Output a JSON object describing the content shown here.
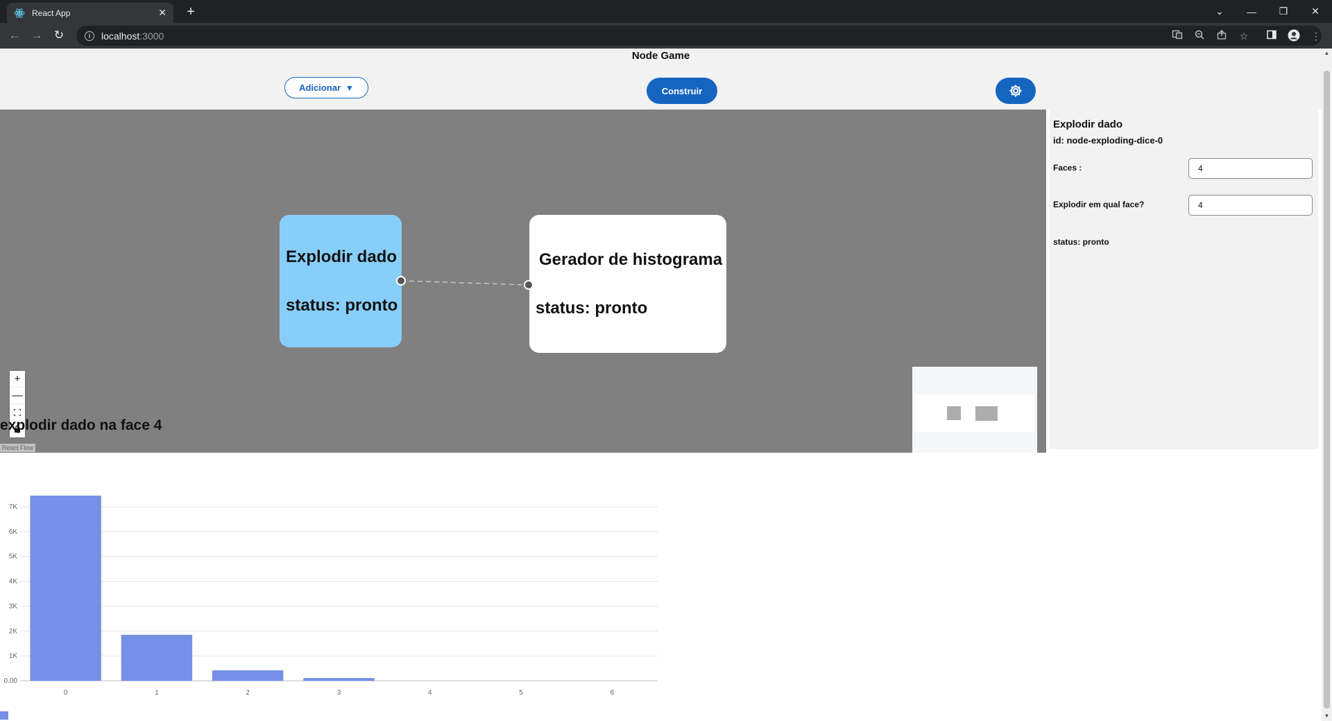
{
  "browser": {
    "tab_title": "React App",
    "tab_close": "✕",
    "new_tab": "+",
    "url_host": "localhost",
    "url_port": ":3000",
    "minimize": "—",
    "restore": "❐",
    "close": "✕",
    "tab_search": "⌄"
  },
  "app": {
    "title": "Node Game",
    "add_button": "Adicionar",
    "add_caret": "▼",
    "build_button": "Construir"
  },
  "flow": {
    "nodes": [
      {
        "title": "Explodir dado",
        "status": "status: pronto",
        "color": "#87cefa"
      },
      {
        "title": "Gerador de histograma",
        "status": "status: pronto",
        "color": "#ffffff"
      }
    ],
    "controls": {
      "zoom_in": "+",
      "zoom_out": "—",
      "fit": "⛶",
      "lock": "🔒"
    },
    "attribution": "React Flow"
  },
  "sidebar": {
    "title": "Explodir dado",
    "id_text": "id: node-exploding-dice-0",
    "fields": [
      {
        "label": "Faces :",
        "value": "4"
      },
      {
        "label": "Explodir em qual face?",
        "value": "4"
      }
    ],
    "status": "status: pronto"
  },
  "chart_title": "explodir dado na face 4",
  "chart_data": {
    "type": "bar",
    "title": "explodir dado na face 4",
    "categories": [
      "0",
      "1",
      "2",
      "3",
      "4",
      "5",
      "6"
    ],
    "series": [
      {
        "values": [
          7450,
          1850,
          420,
          110,
          0,
          0,
          0
        ],
        "color": "#7590e6"
      }
    ],
    "y_ticks": [
      "0.00",
      "1K",
      "2K",
      "3K",
      "4K",
      "5K",
      "6K",
      "7K"
    ],
    "ylim": [
      0,
      7000
    ],
    "grid": true,
    "legend": "bottom-left"
  }
}
